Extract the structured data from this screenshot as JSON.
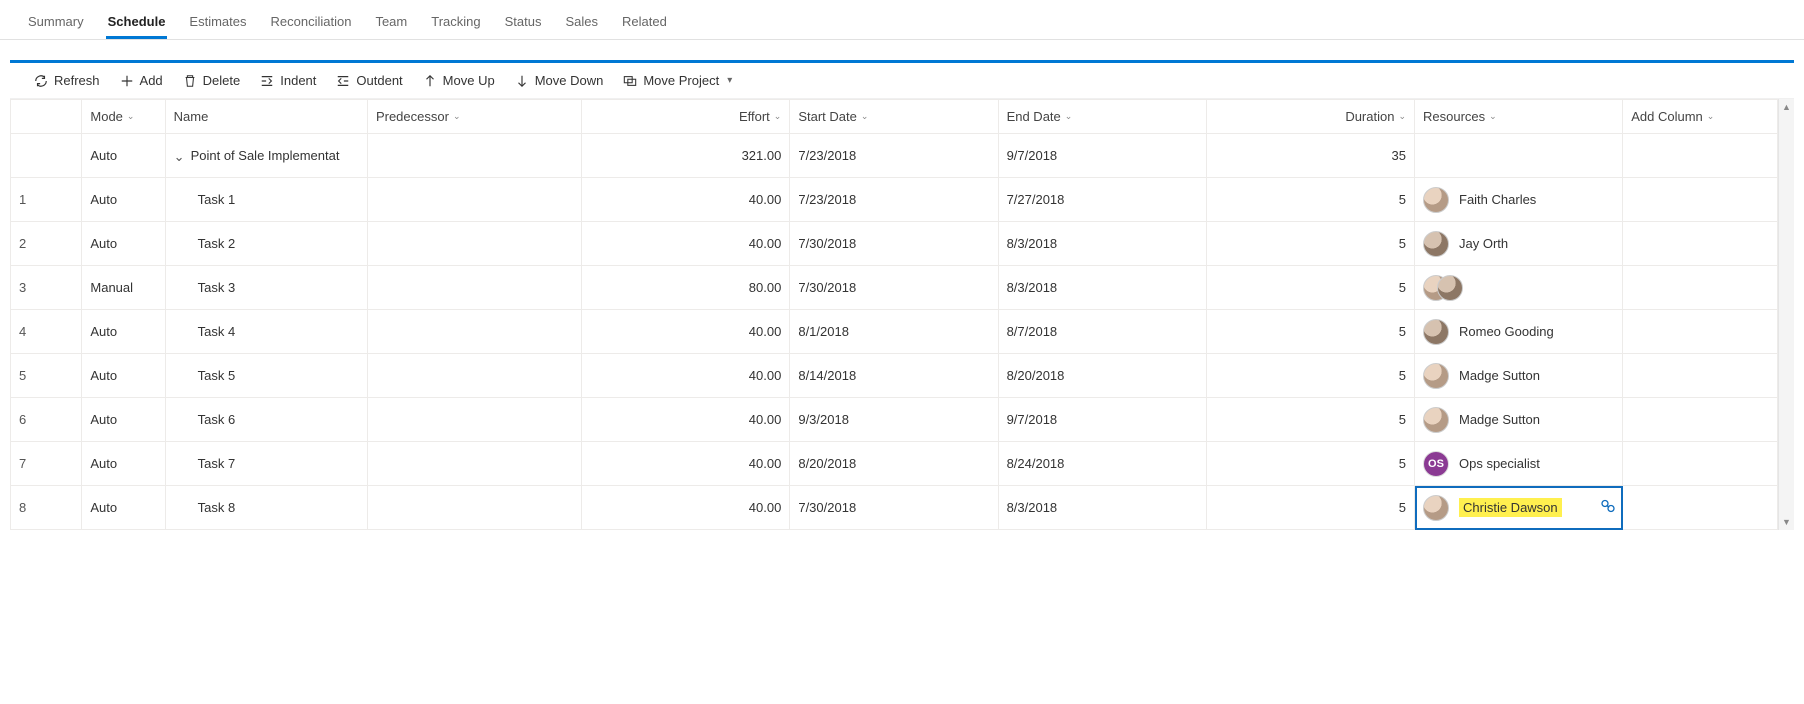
{
  "tabs": [
    "Summary",
    "Schedule",
    "Estimates",
    "Reconciliation",
    "Team",
    "Tracking",
    "Status",
    "Sales",
    "Related"
  ],
  "active_tab": 1,
  "toolbar": {
    "refresh": "Refresh",
    "add": "Add",
    "delete": "Delete",
    "indent": "Indent",
    "outdent": "Outdent",
    "moveup": "Move Up",
    "movedown": "Move Down",
    "moveproject": "Move Project"
  },
  "columns": {
    "mode": "Mode",
    "name": "Name",
    "pred": "Predecessor",
    "effort": "Effort",
    "start": "Start Date",
    "end": "End Date",
    "dur": "Duration",
    "res": "Resources",
    "add": "Add Column"
  },
  "summary": {
    "mode": "Auto",
    "name": "Point of Sale Implementat",
    "effort": "321.00",
    "start": "7/23/2018",
    "end": "9/7/2018",
    "dur": "35"
  },
  "rows": [
    {
      "n": "1",
      "mode": "Auto",
      "name": "Task 1",
      "effort": "40.00",
      "start": "7/23/2018",
      "end": "7/27/2018",
      "dur": "5",
      "res": "Faith Charles",
      "avatar": "photo"
    },
    {
      "n": "2",
      "mode": "Auto",
      "name": "Task 2",
      "effort": "40.00",
      "start": "7/30/2018",
      "end": "8/3/2018",
      "dur": "5",
      "res": "Jay Orth",
      "avatar": "photo2"
    },
    {
      "n": "3",
      "mode": "Manual",
      "name": "Task 3",
      "effort": "80.00",
      "start": "7/30/2018",
      "end": "8/3/2018",
      "dur": "5",
      "res": "",
      "avatar": "pair"
    },
    {
      "n": "4",
      "mode": "Auto",
      "name": "Task 4",
      "effort": "40.00",
      "start": "8/1/2018",
      "end": "8/7/2018",
      "dur": "5",
      "res": "Romeo Gooding",
      "avatar": "photo2"
    },
    {
      "n": "5",
      "mode": "Auto",
      "name": "Task 5",
      "effort": "40.00",
      "start": "8/14/2018",
      "end": "8/20/2018",
      "dur": "5",
      "res": "Madge Sutton",
      "avatar": "photo"
    },
    {
      "n": "6",
      "mode": "Auto",
      "name": "Task 6",
      "effort": "40.00",
      "start": "9/3/2018",
      "end": "9/7/2018",
      "dur": "5",
      "res": "Madge Sutton",
      "avatar": "photo"
    },
    {
      "n": "7",
      "mode": "Auto",
      "name": "Task 7",
      "effort": "40.00",
      "start": "8/20/2018",
      "end": "8/24/2018",
      "dur": "5",
      "res": "Ops specialist",
      "avatar": "OS"
    },
    {
      "n": "8",
      "mode": "Auto",
      "name": "Task 8",
      "effort": "40.00",
      "start": "7/30/2018",
      "end": "8/3/2018",
      "dur": "5",
      "res": "Christie Dawson",
      "avatar": "photo",
      "selected": true
    }
  ]
}
